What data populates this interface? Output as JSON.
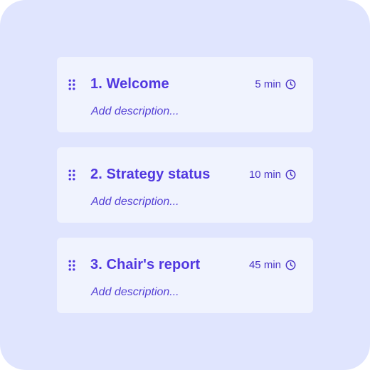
{
  "agenda": {
    "items": [
      {
        "title": "1. Welcome",
        "duration": "5 min",
        "description_placeholder": "Add description..."
      },
      {
        "title": "2. Strategy status",
        "duration": "10 min",
        "description_placeholder": "Add description..."
      },
      {
        "title": "3. Chair's report",
        "duration": "45 min",
        "description_placeholder": "Add description..."
      }
    ]
  },
  "icons": {
    "drag": "drag-handle-icon",
    "time": "clock-icon"
  },
  "colors": {
    "background": "#e0e5fe",
    "card": "#f0f3fe",
    "accent": "#5138e0"
  }
}
